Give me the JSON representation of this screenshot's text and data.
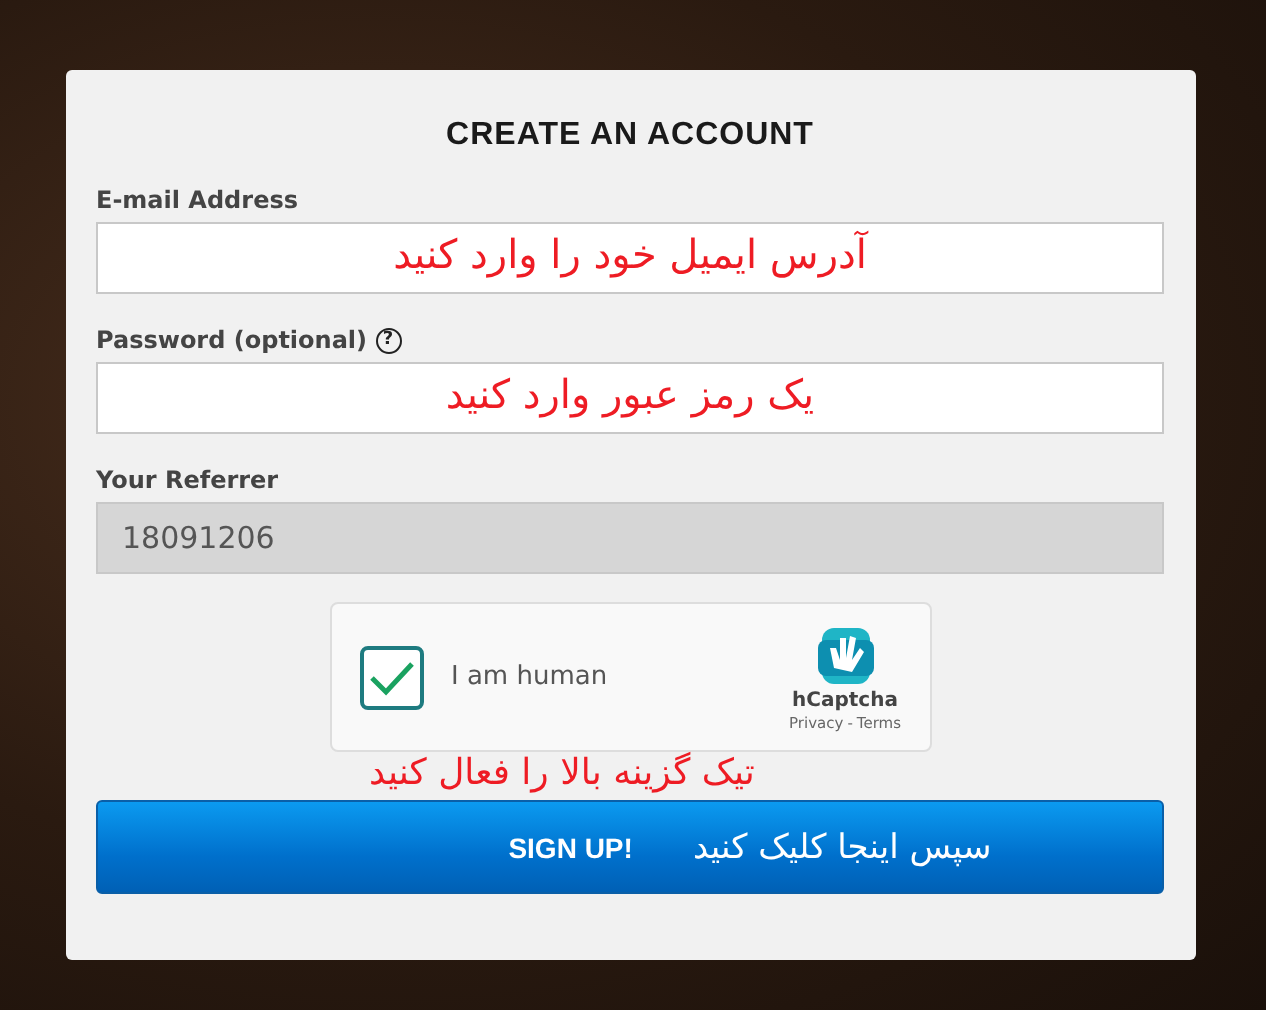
{
  "form": {
    "title": "CREATE AN ACCOUNT",
    "fields": [
      {
        "kind": "text",
        "label": "E-mail Address",
        "annotation": "آدرس ایمیل خود را وارد کنید",
        "disabled": false
      },
      {
        "kind": "text",
        "label": "Password (optional)",
        "help_glyph": "?",
        "annotation": "یک رمز عبور وارد کنید",
        "disabled": false
      },
      {
        "kind": "text",
        "label": "Your Referrer",
        "value": "18091206",
        "disabled": true
      }
    ],
    "captcha": {
      "label": "I am human",
      "checked": true,
      "brand": "hCaptcha",
      "links": [
        "Privacy",
        "Terms"
      ],
      "separator": "-",
      "annotation": "تیک گزینه بالا را فعال کنید"
    },
    "submit": {
      "label": "SIGN UP!",
      "annotation": "سپس اینجا کلیک کنید"
    }
  }
}
